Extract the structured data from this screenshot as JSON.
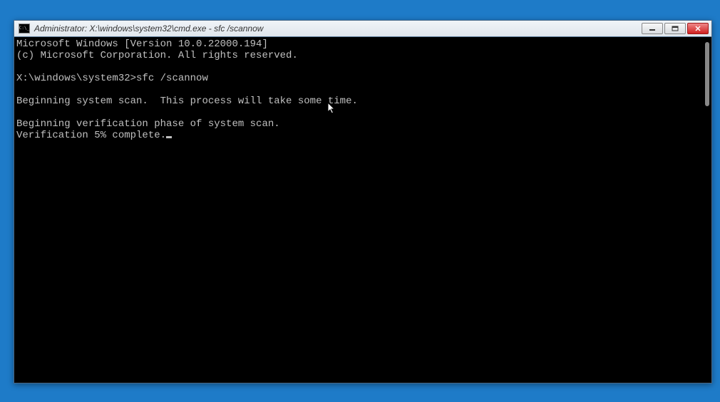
{
  "window": {
    "title": "Administrator: X:\\windows\\system32\\cmd.exe - sfc  /scannow"
  },
  "terminal": {
    "line1": "Microsoft Windows [Version 10.0.22000.194]",
    "line2": "(c) Microsoft Corporation. All rights reserved.",
    "blank1": "",
    "prompt": "X:\\windows\\system32>",
    "command": "sfc /scannow",
    "blank2": "",
    "line3": "Beginning system scan.  This process will take some time.",
    "blank3": "",
    "line4": "Beginning verification phase of system scan.",
    "line5": "Verification 5% complete."
  }
}
